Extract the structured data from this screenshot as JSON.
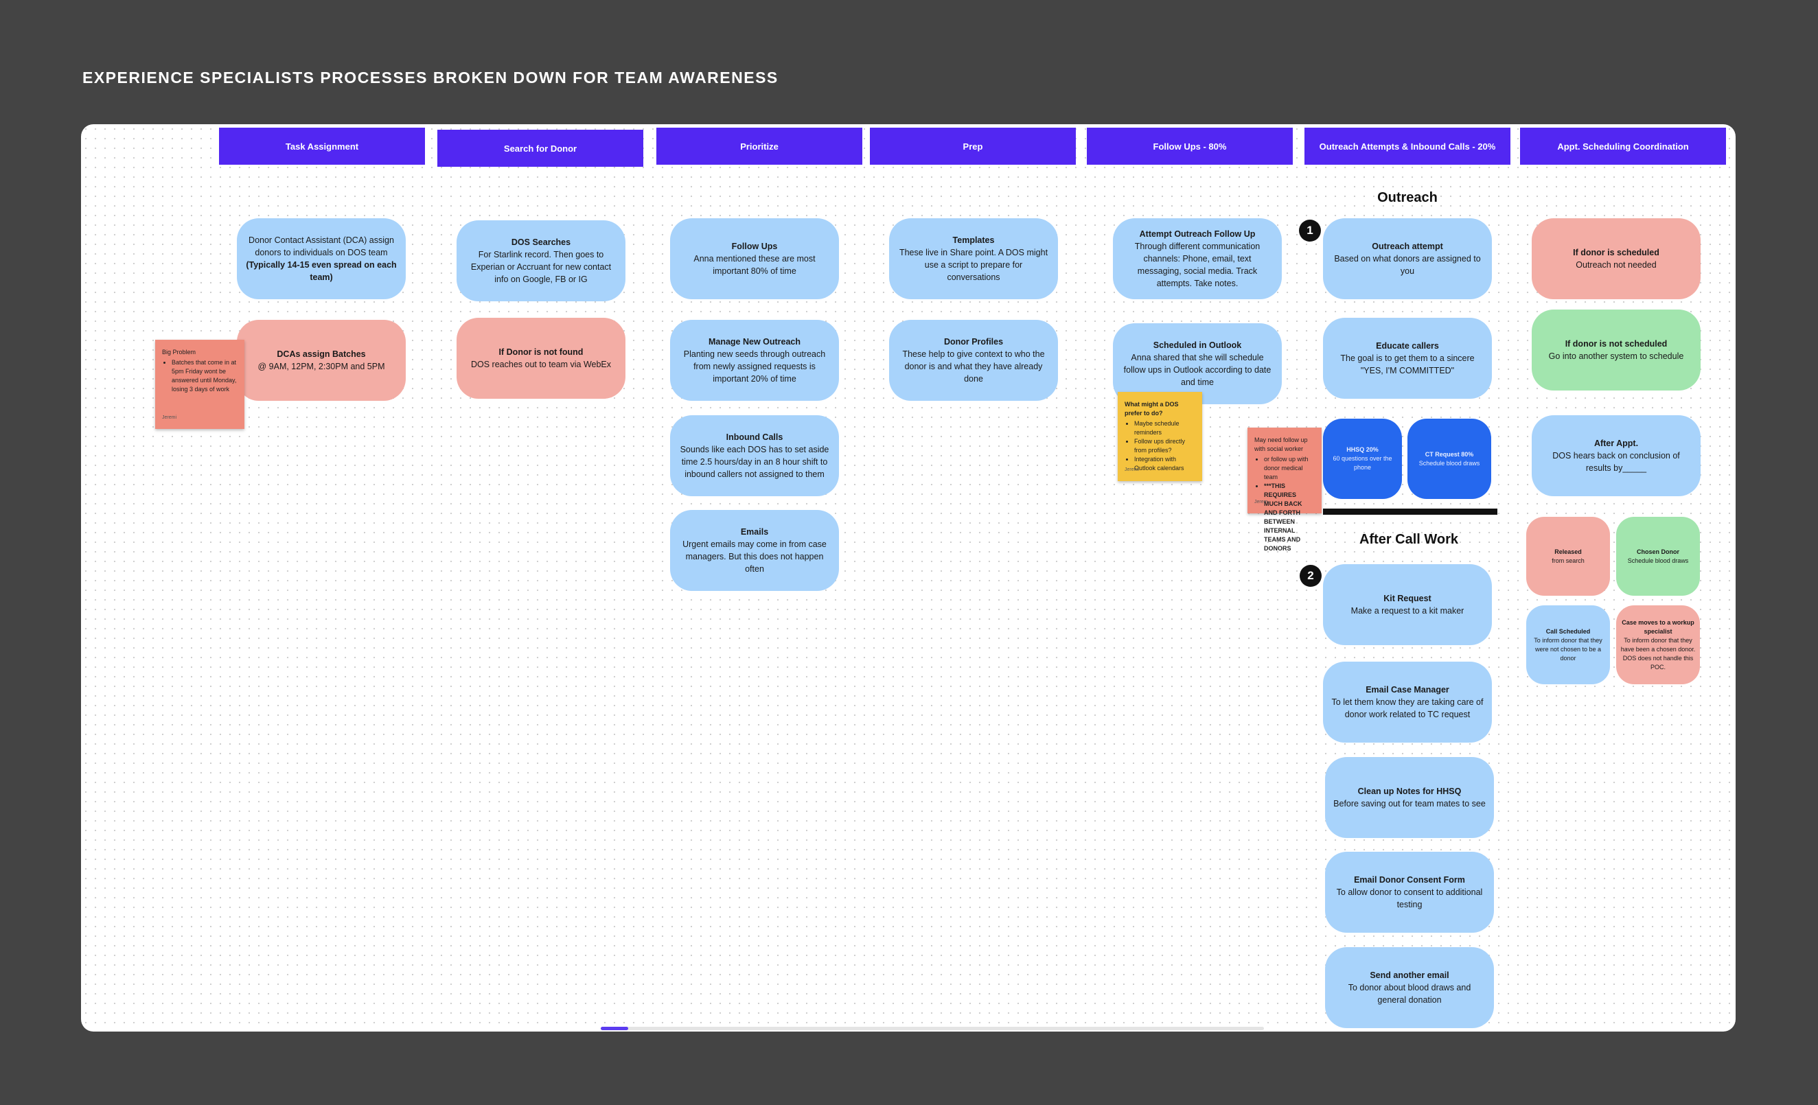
{
  "board_title": "Experience Specialists Processes Broken Down for Team Awareness",
  "columns": [
    "Task Assignment",
    "Search for Donor",
    "Prioritize",
    "Prep",
    "Follow Ups - 80%",
    "Outreach Attempts & Inbound Calls - 20%",
    "Appt. Scheduling Coordination"
  ],
  "sections": {
    "outreach": "Outreach",
    "after_call": "After Call Work",
    "badge1": "1",
    "badge2": "2"
  },
  "colors": {
    "header": "#5227f2",
    "blue_card": "#a8d3fb",
    "pink_card": "#f3ada5",
    "green_card": "#a2e5ae",
    "deep_blue_card": "#2568ee",
    "salmon_sticky": "#ef8c7c",
    "yellow_sticky": "#f4c33f"
  },
  "cards": [
    {
      "title": "",
      "body": "Donor Contact Assistant (DCA) assign donors to individuals on DOS team",
      "body_bold": "(Typically 14-15 even spread on each team)",
      "color": "blue"
    },
    {
      "title": "DCAs assign Batches",
      "body": "@ 9AM, 12PM, 2:30PM and 5PM",
      "body_bold": "",
      "color": "pink"
    },
    {
      "title": "DOS Searches",
      "body": "For Starlink record. Then goes to Experian or Accruant for new contact info on Google, FB or IG",
      "body_bold": "",
      "color": "blue"
    },
    {
      "title": "If Donor is not found",
      "body": "DOS reaches out to team via WebEx",
      "body_bold": "",
      "color": "pink"
    },
    {
      "title": "Follow Ups",
      "body": "Anna mentioned these are most important 80% of time",
      "body_bold": "",
      "color": "blue"
    },
    {
      "title": "Manage New Outreach",
      "body": "Planting new seeds through outreach from newly assigned requests is important 20% of time",
      "body_bold": "",
      "color": "blue"
    },
    {
      "title": "Inbound Calls",
      "body": "Sounds like each DOS has to set aside time 2.5 hours/day in an 8 hour shift to inbound callers not assigned to them",
      "body_bold": "",
      "color": "blue"
    },
    {
      "title": "Emails",
      "body": "Urgent emails may come in from case managers. But this does not happen often",
      "body_bold": "",
      "color": "blue"
    },
    {
      "title": "Templates",
      "body": "These live in Share point. A DOS might use a script to prepare for conversations",
      "body_bold": "",
      "color": "blue"
    },
    {
      "title": "Donor Profiles",
      "body": "These help to give context to who the donor is and what they have already done",
      "body_bold": "",
      "color": "blue"
    },
    {
      "title": "Attempt Outreach Follow Up",
      "body": "Through different communication channels: Phone, email, text messaging, social media. Track attempts. Take notes.",
      "body_bold": "",
      "color": "blue"
    },
    {
      "title": "Scheduled in Outlook",
      "body": "Anna shared that she will schedule follow ups in Outlook according to date and time",
      "body_bold": "",
      "color": "blue"
    },
    {
      "title": "Outreach attempt",
      "body": "Based on what donors are assigned to you",
      "body_bold": "",
      "color": "blue"
    },
    {
      "title": "Educate callers",
      "body": "The goal is to get them to a sincere \"YES, I'M COMMITTED\"",
      "body_bold": "",
      "color": "blue"
    },
    {
      "title": "HHSQ 20%",
      "body": "60 questions over the phone",
      "body_bold": "",
      "color": "deep"
    },
    {
      "title": "CT Request 80%",
      "body": "Schedule blood draws",
      "body_bold": "",
      "color": "deep"
    },
    {
      "title": "Kit Request",
      "body": "Make a request to a kit maker",
      "body_bold": "",
      "color": "blue"
    },
    {
      "title": "Email Case Manager",
      "body": "To let them know they are taking care of donor work related to TC request",
      "body_bold": "",
      "color": "blue"
    },
    {
      "title": "Clean up Notes for HHSQ",
      "body": "Before saving out for team mates to see",
      "body_bold": "",
      "color": "blue"
    },
    {
      "title": "Email Donor Consent Form",
      "body": "To allow donor to consent to additional testing",
      "body_bold": "",
      "color": "blue"
    },
    {
      "title": "Send another email",
      "body": "To donor about blood draws and general donation",
      "body_bold": "",
      "color": "blue"
    },
    {
      "title": "If donor is scheduled",
      "body": "Outreach not needed",
      "body_bold": "",
      "color": "pink"
    },
    {
      "title": "If donor is not scheduled",
      "body": "Go into another system to schedule",
      "body_bold": "",
      "color": "green"
    },
    {
      "title": "After Appt.",
      "body": "DOS hears back on conclusion of results by_____",
      "body_bold": "",
      "color": "blue"
    },
    {
      "title": "Released",
      "body": "from search",
      "body_bold": "",
      "color": "pink"
    },
    {
      "title": "Chosen Donor",
      "body": "Schedule blood draws",
      "body_bold": "",
      "color": "green"
    },
    {
      "title": "Call Scheduled",
      "body": "To inform donor that they were not chosen to be a donor",
      "body_bold": "",
      "color": "blue"
    },
    {
      "title": "Case moves to a workup specialist",
      "body": "To inform donor that they have been a chosen donor. DOS does not handle this POC.",
      "body_bold": "",
      "color": "pink"
    }
  ],
  "stickies": [
    {
      "title": "Big Problem",
      "title_bold": false,
      "bullets": [
        "Batches that come in at 5pm Friday wont be answered until Monday, losing 3 days of work"
      ],
      "bold_bullets": [],
      "author": "Jeremi",
      "color": "salmon"
    },
    {
      "title": "What might a DOS prefer to do?",
      "title_bold": true,
      "bullets": [
        "Maybe schedule reminders",
        "Follow ups directly from profiles?",
        "Integration with Outlook calendars"
      ],
      "bold_bullets": [],
      "author": "Jeremi",
      "color": "yellow"
    },
    {
      "title": "May need follow up with social worker",
      "title_bold": false,
      "bullets": [
        "or follow up with donor medical team"
      ],
      "bold_bullets": [
        "***THIS REQUIRES MUCH BACK AND FORTH BETWEEN INTERNAL TEAMS AND DONORS"
      ],
      "author": "Jerem",
      "color": "salmon"
    }
  ]
}
